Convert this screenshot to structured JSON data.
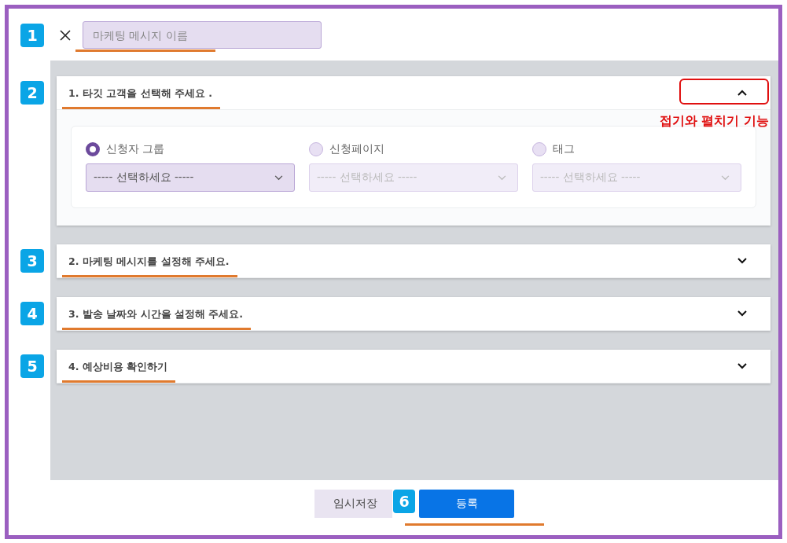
{
  "title_field": {
    "badge": "1",
    "placeholder": "마케팅 메시지 이름"
  },
  "sections": [
    {
      "badge": "2",
      "title": "1. 타깃 고객을 선택해 주세요 .",
      "expanded": true,
      "note": "접기와 펼치기 기능",
      "options": [
        {
          "label": "신청자 그룹",
          "selected": true,
          "select_placeholder": "----- 선택하세요 -----"
        },
        {
          "label": "신청페이지",
          "selected": false,
          "select_placeholder": "----- 선택하세요 -----"
        },
        {
          "label": "태그",
          "selected": false,
          "select_placeholder": "----- 선택하세요 -----"
        }
      ]
    },
    {
      "badge": "3",
      "title": "2. 마케팅 메시지를 설정해 주세요.",
      "expanded": false
    },
    {
      "badge": "4",
      "title": "3. 발송 날짜와 시간을 설정해 주세요.",
      "expanded": false
    },
    {
      "badge": "5",
      "title": "4. 예상비용 확인하기",
      "expanded": false
    }
  ],
  "footer": {
    "badge": "6",
    "buttons": [
      {
        "label": "임시저장",
        "kind": "secondary"
      },
      {
        "label": "등록",
        "kind": "primary"
      }
    ]
  }
}
